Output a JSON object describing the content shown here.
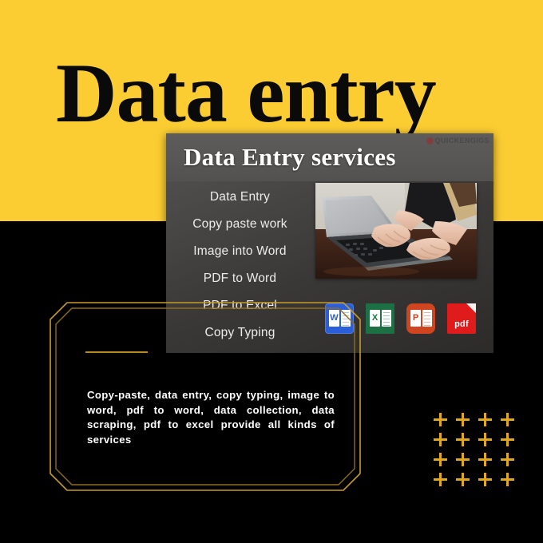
{
  "palette": {
    "yellow": "#fbcd32",
    "black": "#000000",
    "gold": "#c79a2a",
    "card_dark": "#4a4846",
    "white": "#ffffff",
    "word_blue": "#2b5fd9",
    "excel_green": "#1d7044",
    "ppt_orange": "#cf4520",
    "pdf_red": "#e01b1b"
  },
  "header": {
    "title": "Data entry"
  },
  "card": {
    "title": "Data Entry services",
    "watermark": "quickengigs",
    "watermark_icon": "quickengigs-logo-icon",
    "services": [
      "Data Entry",
      "Copy paste work",
      "Image into Word",
      "PDF to Word",
      "PDF to Excel",
      "Copy Typing"
    ],
    "photo_alt": "hands typing on a silver laptop at a dark wooden desk",
    "app_icons": [
      {
        "name": "word-icon",
        "label": "W",
        "caption": ""
      },
      {
        "name": "excel-icon",
        "label": "X",
        "caption": ""
      },
      {
        "name": "powerpoint-icon",
        "label": "P",
        "caption": ""
      },
      {
        "name": "pdf-icon",
        "label": "",
        "caption": "pdf"
      }
    ]
  },
  "footer": {
    "description": "Copy-paste, data entry, copy typing, image to word, pdf to word, data collection, data scraping, pdf to excel provide all kinds of services",
    "decor": {
      "frame": "gold-chamfered-frame",
      "rule": "gold-divider-rule",
      "plus_grid_rows": 4,
      "plus_grid_cols": 4
    }
  }
}
